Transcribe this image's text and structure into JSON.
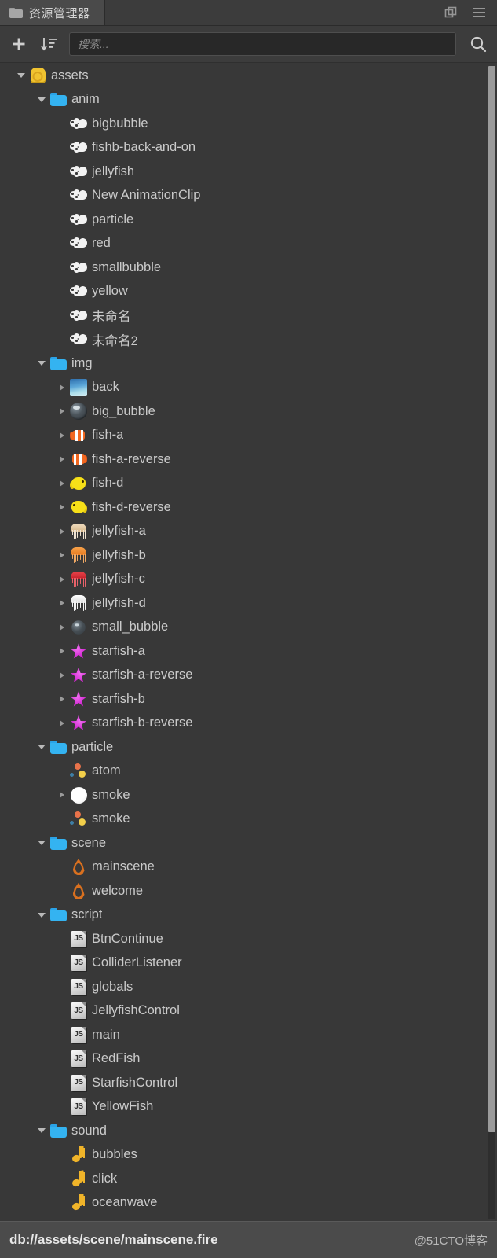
{
  "window": {
    "tab_label": "资源管理器",
    "tab_icon": "folder-icon",
    "action_icons": [
      "popout-window-icon",
      "hamburger-menu-icon"
    ]
  },
  "toolbar": {
    "add_icon": "plus-icon",
    "sort_icon": "sort-descending-icon",
    "search_placeholder": "搜索...",
    "search_value": "",
    "search_icon": "search-icon"
  },
  "statusbar": {
    "path": "db://assets/scene/mainscene.fire",
    "watermark": "@51CTO博客"
  },
  "colors": {
    "panel_bg": "#383838",
    "header_bg": "#3c3c3c",
    "tab_active_bg": "#4a4a4a",
    "text": "#cacaca",
    "folder_blue": "#34b3f1",
    "assets_gold": "#f0c330",
    "scene_orange": "#d9701f",
    "sound_yellow": "#f0b429",
    "starfish_magenta": "#d62fd6",
    "scrollbar": "#9b9b9b",
    "statusbar_bg": "#4b4b4b"
  },
  "tree": [
    {
      "label": "assets",
      "depth": 0,
      "icon": "assets-db-icon",
      "twisty": "down"
    },
    {
      "label": "anim",
      "depth": 1,
      "icon": "folder-icon",
      "twisty": "down"
    },
    {
      "label": "bigbubble",
      "depth": 2,
      "icon": "animation-clip-icon",
      "twisty": "none"
    },
    {
      "label": "fishb-back-and-on",
      "depth": 2,
      "icon": "animation-clip-icon",
      "twisty": "none"
    },
    {
      "label": "jellyfish",
      "depth": 2,
      "icon": "animation-clip-icon",
      "twisty": "none"
    },
    {
      "label": "New AnimationClip",
      "depth": 2,
      "icon": "animation-clip-icon",
      "twisty": "none"
    },
    {
      "label": "particle",
      "depth": 2,
      "icon": "animation-clip-icon",
      "twisty": "none"
    },
    {
      "label": "red",
      "depth": 2,
      "icon": "animation-clip-icon",
      "twisty": "none"
    },
    {
      "label": "smallbubble",
      "depth": 2,
      "icon": "animation-clip-icon",
      "twisty": "none"
    },
    {
      "label": "yellow",
      "depth": 2,
      "icon": "animation-clip-icon",
      "twisty": "none"
    },
    {
      "label": "未命名",
      "depth": 2,
      "icon": "animation-clip-icon",
      "twisty": "none"
    },
    {
      "label": "未命名2",
      "depth": 2,
      "icon": "animation-clip-icon",
      "twisty": "none"
    },
    {
      "label": "img",
      "depth": 1,
      "icon": "folder-icon",
      "twisty": "down"
    },
    {
      "label": "back",
      "depth": 2,
      "icon": "image-back-thumb",
      "twisty": "right"
    },
    {
      "label": "big_bubble",
      "depth": 2,
      "icon": "image-bubble-lg-thumb",
      "twisty": "right"
    },
    {
      "label": "fish-a",
      "depth": 2,
      "icon": "image-fish-a-thumb",
      "twisty": "right"
    },
    {
      "label": "fish-a-reverse",
      "depth": 2,
      "icon": "image-fish-a-reverse-thumb",
      "twisty": "right"
    },
    {
      "label": "fish-d",
      "depth": 2,
      "icon": "image-fish-d-thumb",
      "twisty": "right"
    },
    {
      "label": "fish-d-reverse",
      "depth": 2,
      "icon": "image-fish-d-reverse-thumb",
      "twisty": "right"
    },
    {
      "label": "jellyfish-a",
      "depth": 2,
      "icon": "image-jellyfish-a-thumb",
      "twisty": "right"
    },
    {
      "label": "jellyfish-b",
      "depth": 2,
      "icon": "image-jellyfish-b-thumb",
      "twisty": "right"
    },
    {
      "label": "jellyfish-c",
      "depth": 2,
      "icon": "image-jellyfish-c-thumb",
      "twisty": "right"
    },
    {
      "label": "jellyfish-d",
      "depth": 2,
      "icon": "image-jellyfish-d-thumb",
      "twisty": "right"
    },
    {
      "label": "small_bubble",
      "depth": 2,
      "icon": "image-bubble-sm-thumb",
      "twisty": "right"
    },
    {
      "label": "starfish-a",
      "depth": 2,
      "icon": "image-starfish-a-thumb",
      "twisty": "right"
    },
    {
      "label": "starfish-a-reverse",
      "depth": 2,
      "icon": "image-starfish-a-reverse-thumb",
      "twisty": "right"
    },
    {
      "label": "starfish-b",
      "depth": 2,
      "icon": "image-starfish-b-thumb",
      "twisty": "right"
    },
    {
      "label": "starfish-b-reverse",
      "depth": 2,
      "icon": "image-starfish-b-reverse-thumb",
      "twisty": "right"
    },
    {
      "label": "particle",
      "depth": 1,
      "icon": "folder-icon",
      "twisty": "down"
    },
    {
      "label": "atom",
      "depth": 2,
      "icon": "particle-icon",
      "twisty": "none"
    },
    {
      "label": "smoke",
      "depth": 2,
      "icon": "smoke-circle-icon",
      "twisty": "right"
    },
    {
      "label": "smoke",
      "depth": 2,
      "icon": "particle-icon",
      "twisty": "none"
    },
    {
      "label": "scene",
      "depth": 1,
      "icon": "folder-icon",
      "twisty": "down"
    },
    {
      "label": "mainscene",
      "depth": 2,
      "icon": "scene-fire-icon",
      "twisty": "none"
    },
    {
      "label": "welcome",
      "depth": 2,
      "icon": "scene-fire-icon",
      "twisty": "none"
    },
    {
      "label": "script",
      "depth": 1,
      "icon": "folder-icon",
      "twisty": "down"
    },
    {
      "label": "BtnContinue",
      "depth": 2,
      "icon": "js-script-icon",
      "twisty": "none"
    },
    {
      "label": "ColliderListener",
      "depth": 2,
      "icon": "js-script-icon",
      "twisty": "none"
    },
    {
      "label": "globals",
      "depth": 2,
      "icon": "js-script-icon",
      "twisty": "none"
    },
    {
      "label": "JellyfishControl",
      "depth": 2,
      "icon": "js-script-icon",
      "twisty": "none"
    },
    {
      "label": "main",
      "depth": 2,
      "icon": "js-script-icon",
      "twisty": "none"
    },
    {
      "label": "RedFish",
      "depth": 2,
      "icon": "js-script-icon",
      "twisty": "none"
    },
    {
      "label": "StarfishControl",
      "depth": 2,
      "icon": "js-script-icon",
      "twisty": "none"
    },
    {
      "label": "YellowFish",
      "depth": 2,
      "icon": "js-script-icon",
      "twisty": "none"
    },
    {
      "label": "sound",
      "depth": 1,
      "icon": "folder-icon",
      "twisty": "down"
    },
    {
      "label": "bubbles",
      "depth": 2,
      "icon": "sound-note-icon",
      "twisty": "none"
    },
    {
      "label": "click",
      "depth": 2,
      "icon": "sound-note-icon",
      "twisty": "none"
    },
    {
      "label": "oceanwave",
      "depth": 2,
      "icon": "sound-note-icon",
      "twisty": "none"
    }
  ]
}
